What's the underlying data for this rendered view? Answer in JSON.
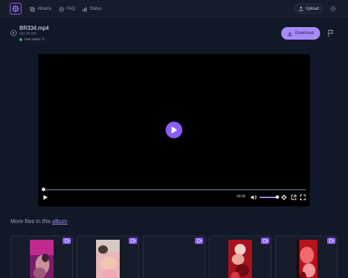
{
  "nav": {
    "items": [
      {
        "label": "Albums",
        "icon": "albums-icon"
      },
      {
        "label": "FAQ",
        "icon": "faq-icon"
      },
      {
        "label": "Status",
        "icon": "status-icon"
      }
    ],
    "upload_label": "Upload"
  },
  "file": {
    "name": "BR334.mp4",
    "size": "430.49 MB",
    "live_users": "Live users: 0",
    "download_label": "Download"
  },
  "player": {
    "time": "00:00",
    "progress": 0,
    "volume": 1
  },
  "more_files": {
    "prefix": "More files in this",
    "link": "album"
  },
  "thumbnails": [
    {
      "kind": "video",
      "has_image": true,
      "palette": "pink"
    },
    {
      "kind": "video",
      "has_image": true,
      "palette": "light"
    },
    {
      "kind": "video",
      "has_image": false,
      "palette": "none"
    },
    {
      "kind": "video",
      "has_image": true,
      "palette": "red"
    },
    {
      "kind": "video",
      "has_image": true,
      "palette": "crimson"
    }
  ],
  "colors": {
    "background": "#111827",
    "accent": "#a78bfa",
    "accent_strong": "#8b5cf6",
    "live": "#22c55e"
  }
}
